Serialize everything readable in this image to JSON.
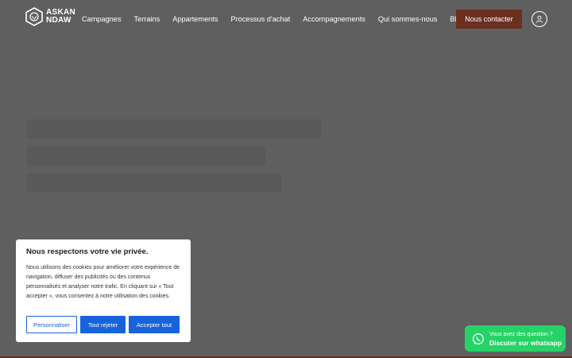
{
  "brand": {
    "line1": "ASKAN",
    "line2": "NDAW"
  },
  "nav": {
    "items": [
      "Campagnes",
      "Terrains",
      "Appartements",
      "Processus d'achat",
      "Accompagnements",
      "Qui sommes-nous",
      "Blog"
    ],
    "contact_label": "Nous contacter"
  },
  "cookie": {
    "title": "Nous respectons votre vie privée.",
    "text": "Nous utilisons des cookies pour améliorer votre expérience de navigation, diffuser des publicités ou des contenus personnalisés et analyser notre trafic. En cliquant sur « Tout accepter », vous consentez à notre utilisation des cookies.",
    "customize_label": "Personnaliser",
    "reject_label": "Tout rejeter",
    "accept_label": "Accepter tout"
  },
  "whatsapp": {
    "question": "Vous avez des question ?",
    "cta": "Discuter sur whatsapp"
  },
  "colors": {
    "overlay": "#5f5f5f",
    "brand_brown": "#6b2f1f",
    "cookie_blue": "#1863dc",
    "whatsapp_green": "#25d366"
  }
}
